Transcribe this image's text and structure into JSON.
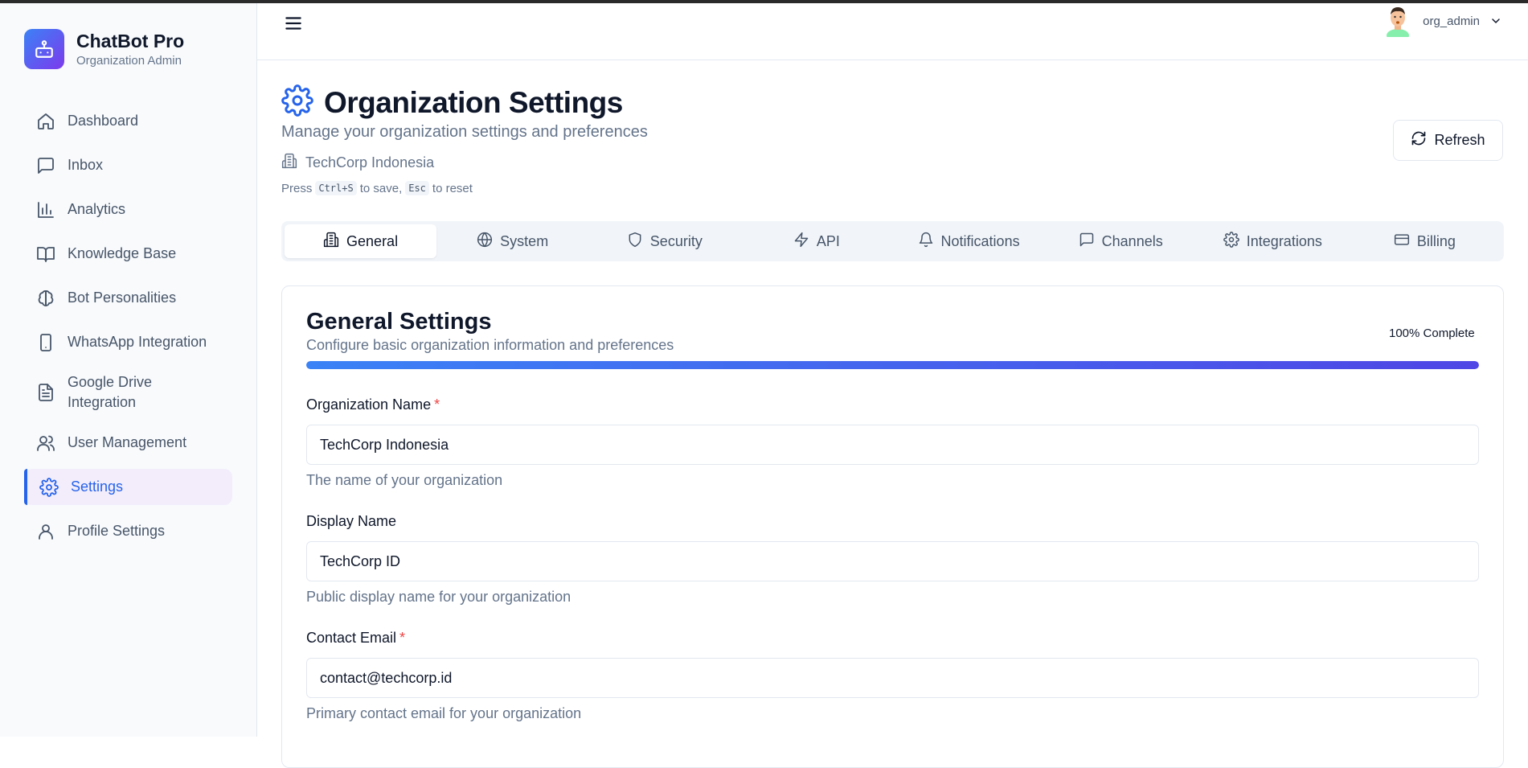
{
  "brand": {
    "title": "ChatBot Pro",
    "subtitle": "Organization Admin"
  },
  "sidebar": {
    "items": [
      {
        "label": "Dashboard",
        "icon": "home-icon",
        "active": false
      },
      {
        "label": "Inbox",
        "icon": "message-square-icon",
        "active": false
      },
      {
        "label": "Analytics",
        "icon": "bar-chart-icon",
        "active": false
      },
      {
        "label": "Knowledge Base",
        "icon": "book-open-icon",
        "active": false
      },
      {
        "label": "Bot Personalities",
        "icon": "brain-icon",
        "active": false
      },
      {
        "label": "WhatsApp Integration",
        "icon": "smartphone-icon",
        "active": false
      },
      {
        "label": "Google Drive Integration",
        "icon": "file-text-icon",
        "active": false
      },
      {
        "label": "User Management",
        "icon": "users-icon",
        "active": false
      },
      {
        "label": "Settings",
        "icon": "settings-icon",
        "active": true
      },
      {
        "label": "Profile Settings",
        "icon": "user-icon",
        "active": false
      }
    ]
  },
  "header": {
    "user_name": "org_admin"
  },
  "page": {
    "title": "Organization Settings",
    "subtitle": "Manage your organization settings and preferences",
    "org_name": "TechCorp Indonesia",
    "hint": {
      "press": "Press",
      "key_save": "Ctrl+S",
      "to_save": "to save,",
      "key_reset": "Esc",
      "to_reset": "to reset"
    },
    "refresh_label": "Refresh"
  },
  "tabs": [
    {
      "label": "General",
      "icon": "building-icon",
      "active": true
    },
    {
      "label": "System",
      "icon": "globe-icon",
      "active": false
    },
    {
      "label": "Security",
      "icon": "shield-icon",
      "active": false
    },
    {
      "label": "API",
      "icon": "zap-icon",
      "active": false
    },
    {
      "label": "Notifications",
      "icon": "bell-icon",
      "active": false
    },
    {
      "label": "Channels",
      "icon": "message-square-icon",
      "active": false
    },
    {
      "label": "Integrations",
      "icon": "settings-icon",
      "active": false
    },
    {
      "label": "Billing",
      "icon": "credit-card-icon",
      "active": false
    }
  ],
  "general": {
    "title": "General Settings",
    "subtitle": "Configure basic organization information and preferences",
    "complete_label": "100% Complete",
    "progress": 1.0,
    "fields": [
      {
        "label": "Organization Name",
        "required": true,
        "value": "TechCorp Indonesia",
        "help": "The name of your organization"
      },
      {
        "label": "Display Name",
        "required": false,
        "value": "TechCorp ID",
        "help": "Public display name for your organization"
      },
      {
        "label": "Contact Email",
        "required": true,
        "value": "contact@techcorp.id",
        "help": "Primary contact email for your organization"
      }
    ]
  },
  "colors": {
    "accent": "#2563eb",
    "active_bg": "#f3edfb",
    "progress_start": "#3b82f6",
    "progress_end": "#4f46e5",
    "required": "#ef4444"
  }
}
